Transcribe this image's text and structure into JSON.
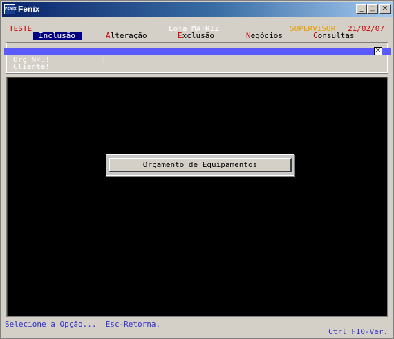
{
  "window": {
    "title": "Fenix",
    "icon_label": "FENIX"
  },
  "titlebar_buttons": {
    "minimize": "_",
    "maximize": "□",
    "close": "✕"
  },
  "header": {
    "company": "TESTE",
    "store": "Loja MATRIZ",
    "user": "SUPERVISOR",
    "date": "21/02/07"
  },
  "menu": [
    {
      "hot": "I",
      "rest": "nclusão"
    },
    {
      "hot": "A",
      "rest": "lteração"
    },
    {
      "hot": "E",
      "rest": "xclusão"
    },
    {
      "hot": "N",
      "rest": "egócios"
    },
    {
      "hot": "C",
      "rest": "onsultas"
    }
  ],
  "form": {
    "orc_label": "Orç Nº.!",
    "orc_end": "!",
    "cliente_label": "Cliente!",
    "close_glyph": "✕"
  },
  "dialog": {
    "option": "Orçamento de Equipamentos"
  },
  "status": {
    "hint": "Selecione a Opção...  Esc-Retorna.",
    "version": "Ctrl_F10-Ver."
  },
  "colors": {
    "menu_selected_bg": "#000080",
    "hotkey": "#cc0000",
    "bar": "#5a5aff",
    "status": "#3333cc"
  }
}
